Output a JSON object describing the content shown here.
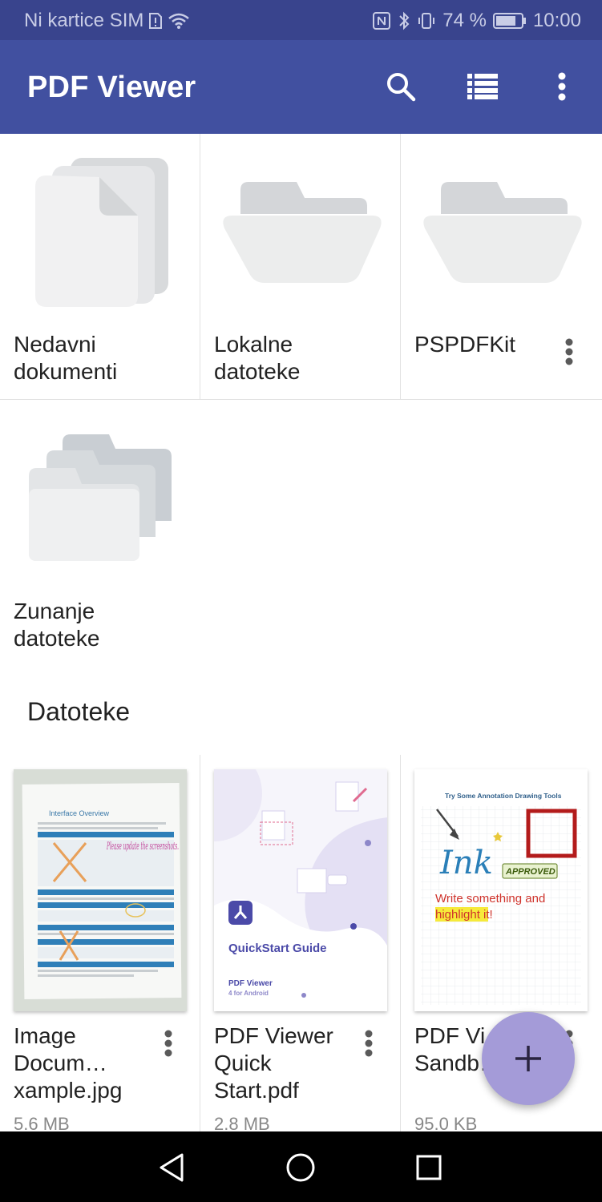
{
  "status_bar": {
    "carrier": "Ni kartice SIM",
    "battery_percent": "74 %",
    "time": "10:00"
  },
  "app_bar": {
    "title": "PDF Viewer",
    "actions": [
      "search-icon",
      "list-view-icon",
      "more-vert-icon"
    ]
  },
  "locations": [
    {
      "label": "Nedavni dokumenti",
      "icon": "recent-documents-icon"
    },
    {
      "label": "Lokalne datoteke",
      "icon": "folder-icon"
    },
    {
      "label": "PSPDFKit",
      "icon": "folder-icon"
    },
    {
      "label": "Zunanje datoteke",
      "icon": "stacked-folders-icon"
    }
  ],
  "files_section": {
    "title": "Datoteke"
  },
  "files": [
    {
      "name": "Image Docum… xample.jpg",
      "size": "5.6 MB"
    },
    {
      "name": "PDF Viewer Quick Start.pdf",
      "size": "2.8 MB"
    },
    {
      "name": "PDF Vi… Sandb… df",
      "size": "95.0 KB"
    }
  ],
  "thumbnails": {
    "doc1_heading": "Interface Overview",
    "doc1_handwriting": "Please update the screenshots.",
    "doc2_title": "QuickStart Guide",
    "doc2_sub1": "PDF Viewer",
    "doc2_sub2": "4 for Android",
    "doc3_heading": "Try Some Annotation Drawing Tools",
    "doc3_ink": "Ink",
    "doc3_stamp": "APPROVED",
    "doc3_text1": "Write something and",
    "doc3_text2": "highlight it!"
  },
  "colors": {
    "status_bar": "#39448d",
    "app_bar": "#4150a0",
    "fab": "#a49bd8",
    "nav_bar": "#000000"
  }
}
